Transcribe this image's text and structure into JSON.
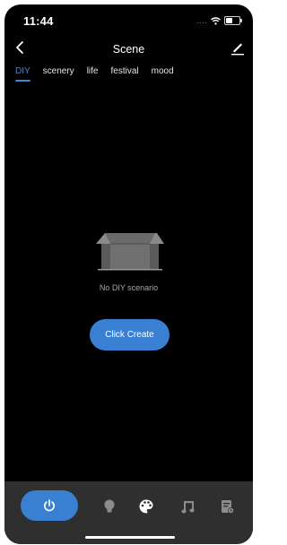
{
  "status": {
    "time": "11:44"
  },
  "header": {
    "title": "Scene"
  },
  "tabs": [
    {
      "label": "DIY",
      "active": true
    },
    {
      "label": "scenery",
      "active": false
    },
    {
      "label": "life",
      "active": false
    },
    {
      "label": "festival",
      "active": false
    },
    {
      "label": "mood",
      "active": false
    }
  ],
  "empty_state": {
    "icon": "empty-box-icon",
    "message": "No DIY scenario",
    "button_label": "Click Create"
  },
  "bottom_nav": [
    {
      "icon": "power-icon",
      "active": true
    },
    {
      "icon": "bulb-icon",
      "active": false
    },
    {
      "icon": "palette-icon",
      "active": false
    },
    {
      "icon": "music-icon",
      "active": false
    },
    {
      "icon": "schedule-icon",
      "active": false
    }
  ],
  "colors": {
    "accent": "#3a80d2",
    "background": "#000000",
    "bottom_bar": "#2f2f2f"
  }
}
